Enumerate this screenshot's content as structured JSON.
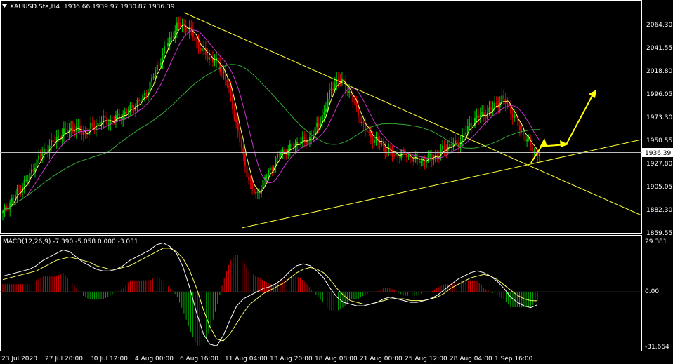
{
  "header": {
    "dropdown_icon": "triangle-down-icon",
    "symbol_label": "XAUUSD.Sta,H4",
    "ohlc_label": "1936.66 1939.97 1930.87 1936.39"
  },
  "indicator": {
    "label": "MACD(12,26,9) -7.390 -5.058 0.000 -3.031"
  },
  "colors": {
    "background": "#000000",
    "grid_frame": "#ffffff",
    "bull_candle": "#00c800",
    "bear_candle": "#dc0000",
    "ma_fast": "#ffff66",
    "ma_mid": "#cc33cc",
    "ma_slow": "#33aa33",
    "trendline": "#ffff33",
    "arrow": "#ffff00",
    "macd_line": "#ffffff",
    "signal_line": "#ffff66",
    "hist_pos": "#dc0000",
    "hist_neg": "#00aa00"
  },
  "chart_data": [
    {
      "type": "candlestick",
      "symbol": "XAUUSD.Sta",
      "timeframe": "H4",
      "last_price": "1936.39",
      "price_axis_labels": [
        "2064.30",
        "2041.55",
        "2018.80",
        "1996.05",
        "1973.30",
        "1950.55",
        "1927.80",
        "1905.05",
        "1882.30",
        "1859.55"
      ],
      "ylim": [
        1859.55,
        2064.3
      ],
      "time_axis_labels": [
        "23 Jul 2020",
        "27 Jul 20:00",
        "30 Jul 12:00",
        "4 Aug 00:00",
        "6 Aug 16:00",
        "11 Aug 04:00",
        "13 Aug 20:00",
        "18 Aug 08:00",
        "21 Aug 00:00",
        "25 Aug 12:00",
        "28 Aug 04:00",
        "1 Sep 16:00"
      ],
      "close_series": [
        1878,
        1888,
        1896,
        1905,
        1912,
        1925,
        1935,
        1942,
        1948,
        1955,
        1958,
        1962,
        1960,
        1956,
        1962,
        1966,
        1970,
        1968,
        1972,
        1975,
        1980,
        1985,
        1990,
        2000,
        2015,
        2030,
        2045,
        2055,
        2065,
        2060,
        2055,
        2042,
        2035,
        2030,
        2025,
        2015,
        1995,
        1965,
        1935,
        1910,
        1895,
        1905,
        1918,
        1928,
        1938,
        1940,
        1944,
        1950,
        1948,
        1955,
        1965,
        1980,
        2000,
        2010,
        2005,
        1995,
        1980,
        1965,
        1955,
        1950,
        1945,
        1940,
        1935,
        1937,
        1935,
        1932,
        1930,
        1931,
        1933,
        1936,
        1942,
        1946,
        1945,
        1955,
        1965,
        1972,
        1975,
        1978,
        1985,
        1990,
        1985,
        1972,
        1960,
        1950,
        1940,
        1936
      ],
      "moving_averages": [
        "fast (yellow)",
        "mid (magenta)",
        "slow (green)"
      ],
      "trendlines": [
        {
          "name": "descending resistance",
          "from": {
            "x": "6 Aug 16:00",
            "y": 2070
          },
          "to": {
            "x": "right edge",
            "y": 1888
          }
        },
        {
          "name": "ascending support",
          "from": {
            "x": "11 Aug 04:00",
            "y": 1864
          },
          "to": {
            "x": "right edge",
            "y": 1949
          }
        }
      ],
      "annotations": [
        "yellow projection arrows pointing up"
      ]
    },
    {
      "type": "macd",
      "params": "12,26,9",
      "values": {
        "macd": -7.39,
        "signal": -5.058,
        "zero": 0.0,
        "histogram": -3.031
      },
      "axis_labels": [
        "29.381",
        "0.00",
        "-31.664"
      ],
      "ylim": [
        -31.664,
        29.381
      ],
      "macd_series": [
        9,
        10,
        11,
        12,
        13,
        15,
        18,
        20,
        22,
        24,
        23,
        20,
        17,
        15,
        13,
        12,
        12,
        13,
        15,
        18,
        20,
        22,
        24,
        27,
        28,
        26,
        22,
        14,
        2,
        -12,
        -24,
        -30,
        -31,
        -25,
        -16,
        -8,
        -4,
        -2,
        0,
        2,
        3,
        5,
        8,
        12,
        15,
        16,
        15,
        12,
        8,
        2,
        -3,
        -6,
        -7,
        -8,
        -8,
        -7,
        -6,
        -4,
        -3,
        -4,
        -5,
        -6,
        -6,
        -5,
        -4,
        -2,
        1,
        4,
        7,
        9,
        11,
        12,
        11,
        9,
        6,
        2,
        -3,
        -6,
        -8,
        -9,
        -7.4
      ],
      "signal_series": [
        7,
        8,
        9,
        10,
        11,
        12,
        14,
        16,
        18,
        19,
        20,
        19,
        18,
        17,
        15,
        14,
        13,
        13,
        14,
        15,
        17,
        19,
        21,
        23,
        25,
        25,
        23,
        19,
        12,
        2,
        -10,
        -20,
        -27,
        -28,
        -24,
        -18,
        -12,
        -7,
        -4,
        -1,
        1,
        3,
        5,
        8,
        11,
        13,
        14,
        13,
        11,
        7,
        2,
        -2,
        -5,
        -6,
        -7,
        -7,
        -6,
        -5,
        -4,
        -4,
        -4,
        -5,
        -5,
        -5,
        -4,
        -3,
        -1,
        2,
        4,
        6,
        8,
        9,
        10,
        9,
        7,
        4,
        1,
        -2,
        -4,
        -5,
        -5.1
      ]
    }
  ]
}
